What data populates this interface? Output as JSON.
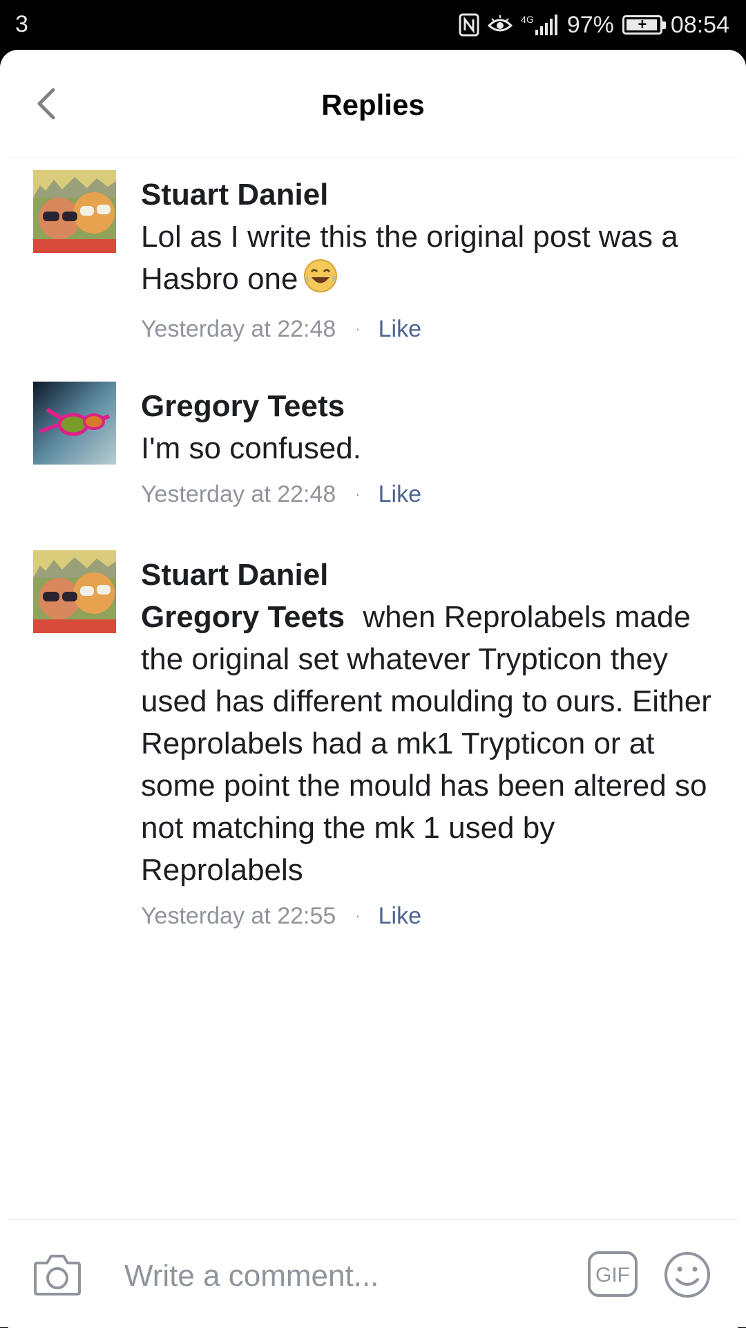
{
  "status_bar": {
    "notification_count": "3",
    "network_label": "4G",
    "battery_percent": "97%",
    "battery_level": 0.97,
    "time": "08:54"
  },
  "header": {
    "title": "Replies",
    "back_icon": "chevron-left-icon"
  },
  "comments": [
    {
      "author": "Stuart Daniel",
      "mention": "",
      "text": "Lol as I write this the original post was a Hasbro one",
      "emoji": "laughing-tears-emoji",
      "timestamp": "Yesterday at 22:48",
      "separator": "·",
      "action": "Like"
    },
    {
      "author": "Gregory Teets",
      "mention": "",
      "text": "I'm so confused.",
      "timestamp": "Yesterday at 22:48",
      "separator": "·",
      "action": "Like"
    },
    {
      "author": "Stuart Daniel",
      "mention": "Gregory Teets",
      "text": "when Reprolabels made the original set whatever Trypticon they used has different moulding to ours. Either Reprolabels had a mk1 Trypticon or at some point the mould has been altered so not matching the mk 1 used by Reprolabels",
      "timestamp": "Yesterday at 22:55",
      "separator": "·",
      "action": "Like"
    }
  ],
  "composer": {
    "placeholder": "Write a comment...",
    "camera_icon": "camera-icon",
    "gif_icon": "gif-icon",
    "emoji_icon": "smiley-icon"
  },
  "colors": {
    "text_primary": "#1c1e21",
    "text_secondary": "#90949c",
    "link": "#4b6492",
    "divider": "#e4e6eb",
    "icon_gray": "#90949c"
  }
}
